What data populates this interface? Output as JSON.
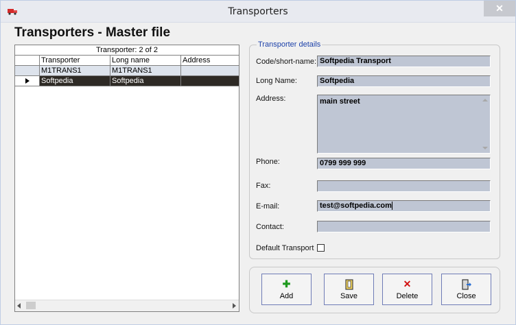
{
  "window": {
    "title": "Transporters",
    "close_glyph": "✕"
  },
  "page_title": "Transporters - Master file",
  "grid": {
    "caption": "Transporter: 2 of 2",
    "columns": [
      "Transporter",
      "Long name",
      "Address"
    ],
    "rows": [
      {
        "transporter": "M1TRANS1",
        "long_name": "M1TRANS1",
        "address": ""
      },
      {
        "transporter": "Softpedia",
        "long_name": "Softpedia",
        "address": ""
      }
    ],
    "selected_row": 2
  },
  "details": {
    "legend": "Transporter details",
    "code_label": "Code/short-name:",
    "code_value": "Softpedia Transport",
    "long_name_label": "Long Name:",
    "long_name_value": "Softpedia",
    "address_label": "Address:",
    "address_value": "main street",
    "phone_label": "Phone:",
    "phone_value": "0799 999 999",
    "fax_label": "Fax:",
    "fax_value": "",
    "email_label": "E-mail:",
    "email_value": "test@softpedia.com",
    "contact_label": "Contact:",
    "contact_value": "",
    "default_label": "Default Transport",
    "default_checked": false
  },
  "buttons": {
    "add": "Add",
    "save": "Save",
    "delete": "Delete",
    "close": "Close"
  },
  "icons": {
    "app": "truck-icon",
    "add": "plus-icon",
    "save": "save-icon",
    "delete": "delete-x-icon",
    "close": "exit-door-icon"
  },
  "colors": {
    "field_bg": "#bfc6d4",
    "selected_row_bg": "#2e2a25",
    "legend_text": "#1a3fa8",
    "button_border": "#6e7bb6"
  }
}
